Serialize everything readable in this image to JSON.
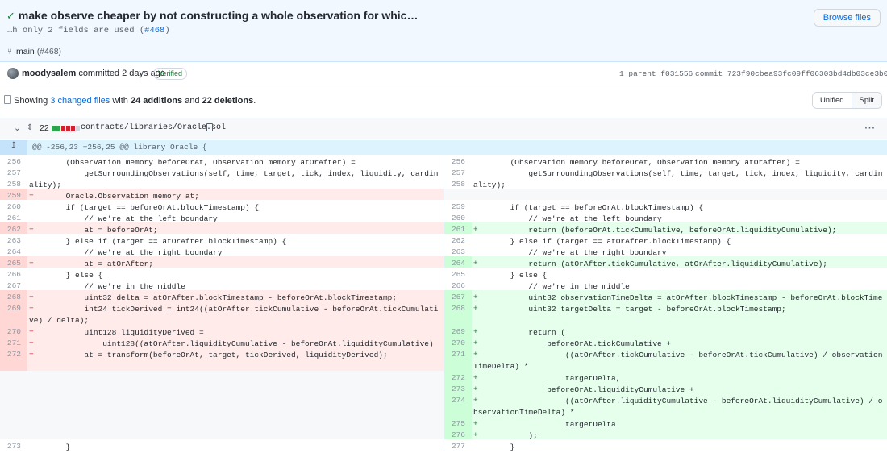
{
  "commit": {
    "title": "make observe cheaper by not constructing a whole observation for whic…",
    "description_text": "…h only 2 fields are used (",
    "pr_ref": "#468",
    "description_close": ")",
    "branch": "main",
    "branch_pr": "(#468)",
    "browse_files_label": "Browse files",
    "author": "moodysalem",
    "committed_text": "committed 2 days ago",
    "verified_label": "Verified",
    "parent_text": "1 parent f031556",
    "commit_text": "commit 723f90cbea93fc09ff06303bd4db03ce3b0847a1"
  },
  "summary": {
    "showing": "Showing ",
    "changed_files": "3 changed files",
    "with": " with ",
    "additions": "24 additions",
    "and": " and ",
    "deletions": "22 deletions",
    "period": "."
  },
  "view_toggle": {
    "unified": "Unified",
    "split": "Split"
  },
  "file": {
    "change_count": "22",
    "path": "contracts/libraries/Oracle.sol",
    "menu_label": "···",
    "hunk_header": "@@ -256,23 +256,25 @@ library Oracle {",
    "stat_colors": [
      "#2da44e",
      "#2da44e",
      "#cf222e",
      "#cf222e",
      "#cf222e",
      "#d0d7de"
    ]
  },
  "diff_rows": [
    {
      "h": 14,
      "l": {
        "n": "256",
        "t": "ctx",
        "c": "        (Observation memory beforeOrAt, Observation memory atOrAfter) ="
      },
      "r": {
        "n": "256",
        "t": "ctx",
        "c": "        (Observation memory beforeOrAt, Observation memory atOrAfter) ="
      }
    },
    {
      "h": 14,
      "l": {
        "n": "257",
        "t": "ctx",
        "c": "            getSurroundingObservations(self, time, target, tick, index, liquidity, cardinality);"
      },
      "r": {
        "n": "257",
        "t": "ctx",
        "c": "            getSurroundingObservations(self, time, target, tick, index, liquidity, cardinality);"
      }
    },
    {
      "h": 14,
      "l": {
        "n": "258",
        "t": "ctx",
        "c": ""
      },
      "r": {
        "n": "258",
        "t": "ctx",
        "c": ""
      }
    },
    {
      "h": 14,
      "l": {
        "n": "259",
        "t": "del",
        "c": "        Oracle.Observation memory at;"
      },
      "r": {
        "n": "",
        "t": "empty",
        "c": ""
      }
    },
    {
      "h": 14,
      "l": {
        "n": "260",
        "t": "ctx",
        "c": "        if (target == beforeOrAt.blockTimestamp) {"
      },
      "r": {
        "n": "259",
        "t": "ctx",
        "c": "        if (target == beforeOrAt.blockTimestamp) {"
      }
    },
    {
      "h": 14,
      "l": {
        "n": "261",
        "t": "ctx",
        "c": "            // we're at the left boundary"
      },
      "r": {
        "n": "260",
        "t": "ctx",
        "c": "            // we're at the left boundary"
      }
    },
    {
      "h": 14,
      "l": {
        "n": "262",
        "t": "del",
        "c": "            at = beforeOrAt;"
      },
      "r": {
        "n": "261",
        "t": "add",
        "c": "            return (beforeOrAt.tickCumulative, beforeOrAt.liquidityCumulative);"
      }
    },
    {
      "h": 14,
      "l": {
        "n": "263",
        "t": "ctx",
        "c": "        } else if (target == atOrAfter.blockTimestamp) {"
      },
      "r": {
        "n": "262",
        "t": "ctx",
        "c": "        } else if (target == atOrAfter.blockTimestamp) {"
      }
    },
    {
      "h": 14,
      "l": {
        "n": "264",
        "t": "ctx",
        "c": "            // we're at the right boundary"
      },
      "r": {
        "n": "263",
        "t": "ctx",
        "c": "            // we're at the right boundary"
      }
    },
    {
      "h": 14,
      "l": {
        "n": "265",
        "t": "del",
        "c": "            at = atOrAfter;"
      },
      "r": {
        "n": "264",
        "t": "add",
        "c": "            return (atOrAfter.tickCumulative, atOrAfter.liquidityCumulative);"
      }
    },
    {
      "h": 14,
      "l": {
        "n": "266",
        "t": "ctx",
        "c": "        } else {"
      },
      "r": {
        "n": "265",
        "t": "ctx",
        "c": "        } else {"
      }
    },
    {
      "h": 14,
      "l": {
        "n": "267",
        "t": "ctx",
        "c": "            // we're in the middle"
      },
      "r": {
        "n": "266",
        "t": "ctx",
        "c": "            // we're in the middle"
      }
    },
    {
      "h": 14,
      "l": {
        "n": "268",
        "t": "del",
        "c": "            uint32 delta = atOrAfter.blockTimestamp - beforeOrAt.blockTimestamp;"
      },
      "r": {
        "n": "267",
        "t": "add",
        "c": "            uint32 observationTimeDelta = atOrAfter.blockTimestamp - beforeOrAt.blockTimestamp;"
      }
    },
    {
      "h": 29,
      "l": {
        "n": "269",
        "t": "del",
        "c": "            int24 tickDerived = int24((atOrAfter.tickCumulative - beforeOrAt.tickCumulative) / delta);"
      },
      "r": {
        "n": "268",
        "t": "add",
        "c": "            uint32 targetDelta = target - beforeOrAt.blockTimestamp;"
      }
    },
    {
      "h": 14,
      "l": {
        "n": "270",
        "t": "del",
        "c": "            uint128 liquidityDerived ="
      },
      "r": {
        "n": "269",
        "t": "add",
        "c": "            return ("
      }
    },
    {
      "h": 14,
      "l": {
        "n": "271",
        "t": "del",
        "c": "                uint128((atOrAfter.liquidityCumulative - beforeOrAt.liquidityCumulative) / delta);"
      },
      "r": {
        "n": "270",
        "t": "add",
        "c": "                beforeOrAt.tickCumulative +"
      }
    },
    {
      "h": 29,
      "l": {
        "n": "272",
        "t": "del",
        "c": "            at = transform(beforeOrAt, target, tickDerived, liquidityDerived);"
      },
      "r": {
        "n": "271",
        "t": "add",
        "c": "                    ((atOrAfter.tickCumulative - beforeOrAt.tickCumulative) / observationTimeDelta) *"
      }
    },
    {
      "h": 14,
      "l": {
        "n": "",
        "t": "empty",
        "c": ""
      },
      "r": {
        "n": "272",
        "t": "add",
        "c": "                    targetDelta,"
      }
    },
    {
      "h": 14,
      "l": {
        "n": "",
        "t": "empty",
        "c": ""
      },
      "r": {
        "n": "273",
        "t": "add",
        "c": "                beforeOrAt.liquidityCumulative +"
      }
    },
    {
      "h": 29,
      "l": {
        "n": "",
        "t": "empty",
        "c": ""
      },
      "r": {
        "n": "274",
        "t": "add",
        "c": "                    ((atOrAfter.liquidityCumulative - beforeOrAt.liquidityCumulative) / observationTimeDelta) *"
      }
    },
    {
      "h": 14,
      "l": {
        "n": "",
        "t": "empty",
        "c": ""
      },
      "r": {
        "n": "275",
        "t": "add",
        "c": "                    targetDelta"
      }
    },
    {
      "h": 14,
      "l": {
        "n": "",
        "t": "empty",
        "c": ""
      },
      "r": {
        "n": "276",
        "t": "add",
        "c": "            );"
      }
    },
    {
      "h": 14,
      "l": {
        "n": "273",
        "t": "ctx",
        "c": "        }"
      },
      "r": {
        "n": "277",
        "t": "ctx",
        "c": "        }"
      }
    }
  ]
}
